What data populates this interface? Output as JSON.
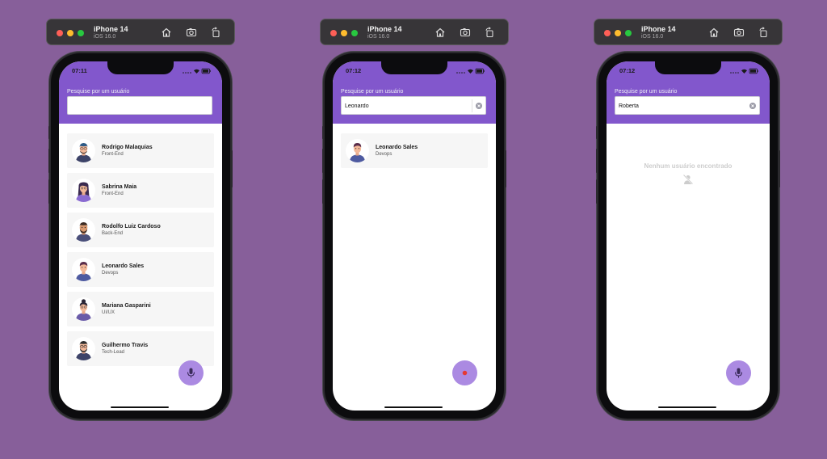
{
  "colors": {
    "background": "#875f9a",
    "header": "#8257cc",
    "fab": "#ab8ae2",
    "card": "#f6f6f6",
    "recording_dot": "#e53935"
  },
  "simulators": [
    {
      "device": "iPhone 14",
      "os": "iOS 16.0",
      "time": "07:11",
      "search_label": "Pesquise por um usuário",
      "search_value": "",
      "users": [
        {
          "name": "Rodrigo Malaquias",
          "role": "Front-End"
        },
        {
          "name": "Sabrina Maia",
          "role": "Front-End"
        },
        {
          "name": "Rodolfo Luiz Cardoso",
          "role": "Back-End"
        },
        {
          "name": "Leonardo Sales",
          "role": "Devops"
        },
        {
          "name": "Mariana Gasparini",
          "role": "UI/UX"
        },
        {
          "name": "Guilhermo Travis",
          "role": "Tech-Lead"
        }
      ],
      "fab_icon": "microphone-icon"
    },
    {
      "device": "iPhone 14",
      "os": "iOS 16.0",
      "time": "07:12",
      "search_label": "Pesquise por um usuário",
      "search_value": "Leonardo",
      "users": [
        {
          "name": "Leonardo Sales",
          "role": "Devops"
        }
      ],
      "fab_icon": "recording-dot-icon"
    },
    {
      "device": "iPhone 14",
      "os": "iOS 16.0",
      "time": "07:12",
      "search_label": "Pesquise por um usuário",
      "search_value": "Roberta",
      "empty_message": "Nenhum usuário encontrado",
      "empty_icon": "user-slash-icon",
      "fab_icon": "microphone-icon"
    }
  ]
}
